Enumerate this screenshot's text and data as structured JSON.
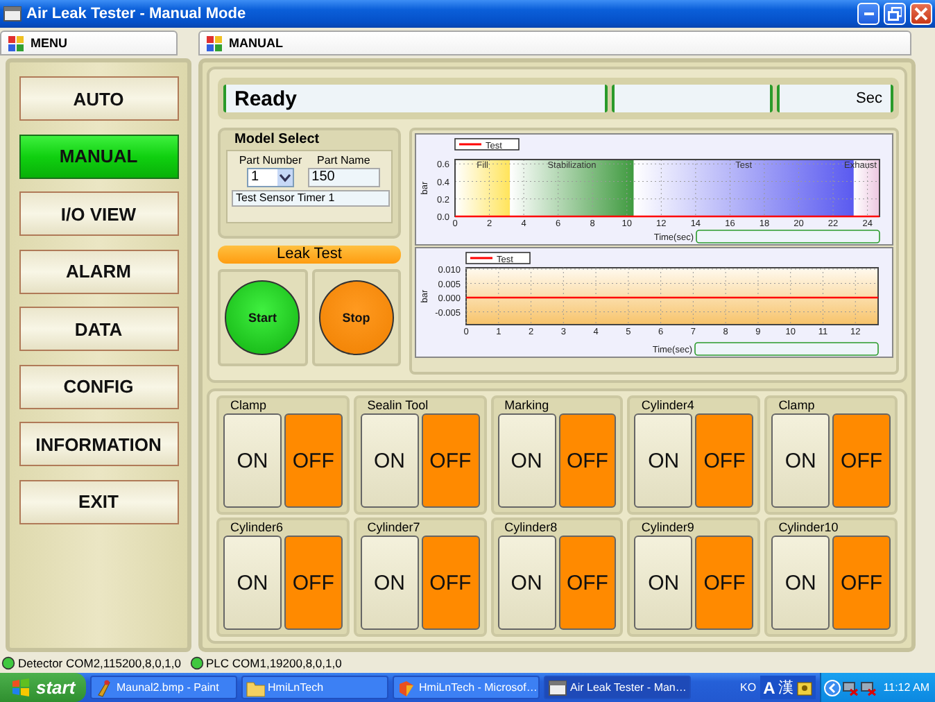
{
  "window": {
    "title": "Air Leak Tester - Manual Mode"
  },
  "menu_panel": {
    "header": "MENU",
    "items": [
      {
        "label": "AUTO",
        "selected": false
      },
      {
        "label": "MANUAL",
        "selected": true
      },
      {
        "label": "I/O VIEW",
        "selected": false
      },
      {
        "label": "ALARM",
        "selected": false
      },
      {
        "label": "DATA",
        "selected": false
      },
      {
        "label": "CONFIG",
        "selected": false
      },
      {
        "label": "INFORMATION",
        "selected": false
      },
      {
        "label": "EXIT",
        "selected": false
      }
    ]
  },
  "manual_panel": {
    "header": "MANUAL",
    "status": {
      "message": "Ready",
      "unit": "Sec"
    },
    "model_select": {
      "title": "Model Select",
      "part_number_label": "Part Number",
      "part_number": "1",
      "part_name_label": "Part Name",
      "part_name": "150",
      "description": "Test Sensor Timer 1"
    },
    "leak_test": {
      "title": "Leak Test",
      "start_button": "Start",
      "stop_button": "Stop"
    },
    "charts": [
      {
        "chart_data": {
          "type": "line",
          "grid": true,
          "x": [
            0,
            24.7
          ],
          "xlabel": "Time(sec)",
          "ylabel": "bar",
          "xlim": [
            0,
            24.7
          ],
          "ylim": [
            0,
            0.65
          ],
          "xticks": [
            0,
            2,
            4,
            6,
            8,
            10,
            12,
            14,
            16,
            18,
            20,
            22,
            24
          ],
          "yticks": [
            {
              "value": 0,
              "label": "0.0"
            },
            {
              "value": 0.2,
              "label": "0.2"
            },
            {
              "value": 0.4,
              "label": "0.4"
            },
            {
              "value": 0.6,
              "label": "0.6"
            }
          ],
          "series": [
            {
              "name": "Test",
              "color": "#ff0000",
              "values": [
                0,
                0
              ]
            }
          ],
          "bands": [
            {
              "axis": "x",
              "label": "Fill",
              "from": 0,
              "to": 3.2,
              "color": "#ffe45a"
            },
            {
              "axis": "x",
              "label": "Stabilization",
              "from": 3.2,
              "to": 10.4,
              "color": "#3f9a3f"
            },
            {
              "axis": "x",
              "label": "Test",
              "from": 10.4,
              "to": 23.2,
              "color": "#5a5af0"
            },
            {
              "axis": "x",
              "label": "Exhaust",
              "from": 23.2,
              "to": 24.7,
              "color": "#ecc6e0"
            }
          ]
        }
      },
      {
        "chart_data": {
          "type": "line",
          "grid": true,
          "x": [
            0,
            12.7
          ],
          "xlabel": "Time(sec)",
          "ylabel": "bar",
          "xlim": [
            0,
            12.7
          ],
          "ylim": [
            -0.0095,
            0.0105
          ],
          "xticks": [
            0,
            1,
            2,
            3,
            4,
            5,
            6,
            7,
            8,
            9,
            10,
            11,
            12
          ],
          "yticks": [
            {
              "value": -0.005,
              "label": "-0.005"
            },
            {
              "value": 0,
              "label": "0.000"
            },
            {
              "value": 0.005,
              "label": "0.005"
            },
            {
              "value": 0.01,
              "label": "0.010"
            }
          ],
          "series": [
            {
              "name": "Test",
              "color": "#ff0000",
              "values": [
                0,
                0
              ]
            }
          ]
        }
      }
    ],
    "toggles": [
      {
        "label": "Clamp",
        "on_label": "ON",
        "off_label": "OFF",
        "on": false
      },
      {
        "label": "Sealin Tool",
        "on_label": "ON",
        "off_label": "OFF",
        "on": false
      },
      {
        "label": "Marking",
        "on_label": "ON",
        "off_label": "OFF",
        "on": false
      },
      {
        "label": "Cylinder4",
        "on_label": "ON",
        "off_label": "OFF",
        "on": false
      },
      {
        "label": "Clamp",
        "on_label": "ON",
        "off_label": "OFF",
        "on": false
      },
      {
        "label": "Cylinder6",
        "on_label": "ON",
        "off_label": "OFF",
        "on": false
      },
      {
        "label": "Cylinder7",
        "on_label": "ON",
        "off_label": "OFF",
        "on": false
      },
      {
        "label": "Cylinder8",
        "on_label": "ON",
        "off_label": "OFF",
        "on": false
      },
      {
        "label": "Cylinder9",
        "on_label": "ON",
        "off_label": "OFF",
        "on": false
      },
      {
        "label": "Cylinder10",
        "on_label": "ON",
        "off_label": "OFF",
        "on": false
      }
    ]
  },
  "status_bar": [
    {
      "text": "Detector COM2,115200,8,0,1,0"
    },
    {
      "text": "PLC COM1,19200,8,0,1,0"
    }
  ],
  "taskbar": {
    "start": "start",
    "tasks": [
      {
        "label": "Maunal2.bmp - Paint",
        "kind": "paint",
        "selected": false
      },
      {
        "label": "HmiLnTech",
        "kind": "folder",
        "selected": false
      },
      {
        "label": "HmiLnTech - Microsof…",
        "kind": "office",
        "selected": false
      },
      {
        "label": "Air Leak Tester - Man…",
        "kind": "window",
        "selected": true
      }
    ],
    "tray": {
      "language": "KO",
      "input_mode": "A",
      "hanja": "漢",
      "time": "11:12 AM"
    }
  }
}
